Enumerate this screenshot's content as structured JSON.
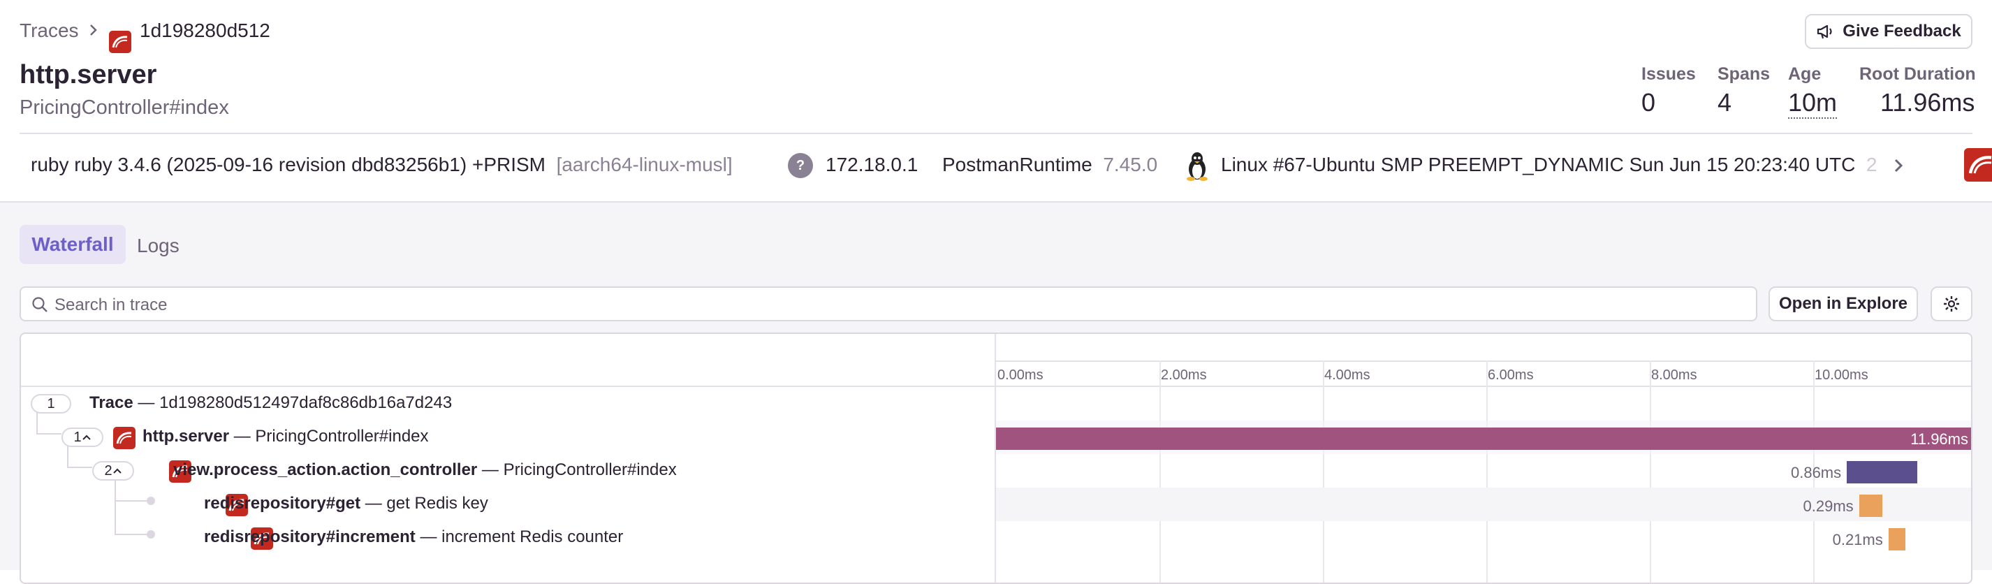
{
  "breadcrumb": {
    "parent": "Traces",
    "current": "1d198280d512"
  },
  "header": {
    "title": "http.server",
    "subtitle": "PricingController#index",
    "feedback_label": "Give Feedback"
  },
  "stats": [
    {
      "label": "Issues",
      "value": "0"
    },
    {
      "label": "Spans",
      "value": "4"
    },
    {
      "label": "Age",
      "value": "10m"
    },
    {
      "label": "Root Duration",
      "value": "11.96ms"
    }
  ],
  "context": {
    "runtime": "ruby ruby 3.4.6 (2025-09-16 revision dbd83256b1) +PRISM",
    "runtime_arch": "[aarch64-linux-musl]",
    "ip": "172.18.0.1",
    "client_name": "PostmanRuntime",
    "client_version": "7.45.0",
    "os": "Linux #67-Ubuntu SMP PREEMPT_DYNAMIC Sun Jun 15 20:23:40 UTC",
    "os_overflow": "2"
  },
  "tabs": {
    "waterfall": "Waterfall",
    "logs": "Logs"
  },
  "search": {
    "placeholder": "Search in trace"
  },
  "open_explore_label": "Open in Explore",
  "colors": {
    "accent": "#6c5fc7",
    "root_bar": "#a0537f",
    "view_bar": "#5b4f8e",
    "redis_bar": "#e9a15c",
    "rails_red": "#c4291f"
  },
  "timeline": {
    "ticks": [
      "0.00ms",
      "2.00ms",
      "4.00ms",
      "6.00ms",
      "8.00ms",
      "10.00ms"
    ]
  },
  "rows": {
    "trace": {
      "count": "1",
      "name": "Trace",
      "desc": "1d198280d512497daf8c86db16a7d243"
    },
    "http": {
      "count": "1",
      "name": "http.server",
      "desc": "PricingController#index",
      "duration": "11.96ms",
      "start_ms": 0,
      "duration_ms": 11.96
    },
    "view": {
      "count": "2",
      "name": "view.process_action.action_controller",
      "desc": "PricingController#index",
      "duration": "0.86ms",
      "start_ms": 10.42,
      "duration_ms": 0.86
    },
    "get": {
      "name": "redisrepository#get",
      "desc": "get Redis key",
      "duration": "0.29ms",
      "start_ms": 10.57,
      "duration_ms": 0.29
    },
    "incr": {
      "name": "redisrepository#increment",
      "desc": "increment Redis counter",
      "duration": "0.21ms",
      "start_ms": 10.93,
      "duration_ms": 0.21
    }
  }
}
